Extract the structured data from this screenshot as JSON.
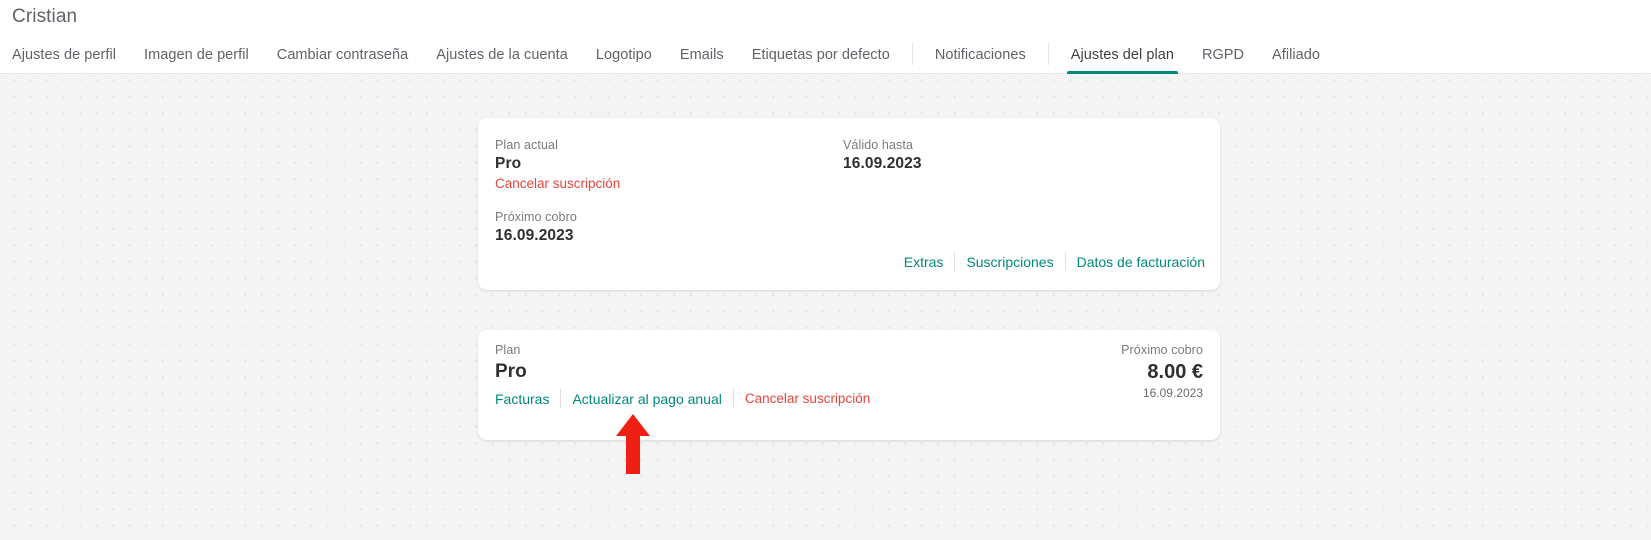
{
  "header": {
    "title": "Cristian",
    "tabs": [
      {
        "label": "Ajustes de perfil",
        "active": false
      },
      {
        "label": "Imagen de perfil",
        "active": false
      },
      {
        "label": "Cambiar contraseña",
        "active": false
      },
      {
        "label": "Ajustes de la cuenta",
        "active": false
      },
      {
        "label": "Logotipo",
        "active": false
      },
      {
        "label": "Emails",
        "active": false
      },
      {
        "label": "Etiquetas por defecto",
        "active": false
      },
      {
        "label": "Notificaciones",
        "active": false
      },
      {
        "label": "Ajustes del plan",
        "active": true
      },
      {
        "label": "RGPD",
        "active": false
      },
      {
        "label": "Afiliado",
        "active": false
      }
    ]
  },
  "current_plan_card": {
    "plan_label": "Plan actual",
    "plan_value": "Pro",
    "cancel_link": "Cancelar suscripción",
    "next_charge_label": "Próximo cobro",
    "next_charge_value": "16.09.2023",
    "valid_until_label": "Válido hasta",
    "valid_until_value": "16.09.2023",
    "actions": [
      "Extras",
      "Suscripciones",
      "Datos de facturación"
    ]
  },
  "subscription_card": {
    "plan_label": "Plan",
    "plan_value": "Pro",
    "invoices_link": "Facturas",
    "upgrade_link": "Actualizar al pago anual",
    "cancel_link": "Cancelar suscripción",
    "next_charge_label": "Próximo cobro",
    "amount": "8.00 €",
    "date": "16.09.2023"
  },
  "annotation": {
    "icon": "up-arrow-icon",
    "color": "#f01f13",
    "points_at": "Actualizar al pago anual"
  },
  "colors": {
    "accent_teal": "#00897b",
    "danger_red": "#e8453c",
    "annotation_red": "#f01f13",
    "background": "#f4f4f4",
    "card": "#ffffff"
  }
}
